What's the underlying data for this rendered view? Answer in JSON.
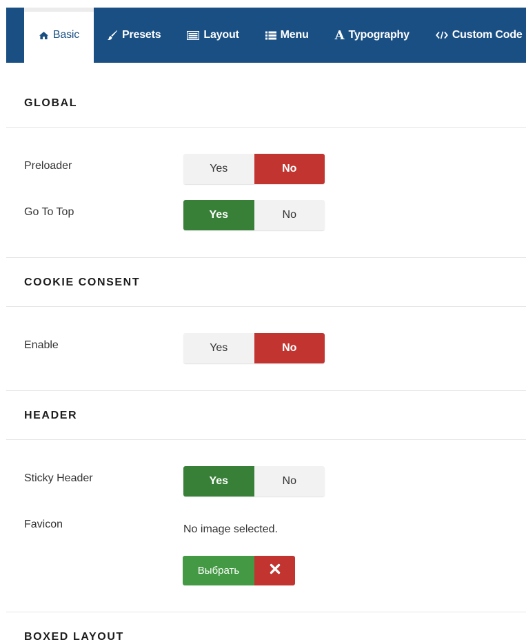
{
  "tabs": [
    {
      "label": "Basic",
      "icon": "home-icon",
      "active": true
    },
    {
      "label": "Presets",
      "icon": "brush-icon"
    },
    {
      "label": "Layout",
      "icon": "layout-icon"
    },
    {
      "label": "Menu",
      "icon": "list-icon"
    },
    {
      "label": "Typography",
      "icon": "typography-icon"
    },
    {
      "label": "Custom Code",
      "icon": "code-icon"
    }
  ],
  "sections": {
    "global": {
      "title": "GLOBAL",
      "preloader": {
        "label": "Preloader",
        "yes": "Yes",
        "no": "No",
        "value": "No"
      },
      "go_to_top": {
        "label": "Go To Top",
        "yes": "Yes",
        "no": "No",
        "value": "Yes"
      }
    },
    "cookie": {
      "title": "COOKIE CONSENT",
      "enable": {
        "label": "Enable",
        "yes": "Yes",
        "no": "No",
        "value": "No"
      }
    },
    "header": {
      "title": "HEADER",
      "sticky": {
        "label": "Sticky Header",
        "yes": "Yes",
        "no": "No",
        "value": "Yes"
      },
      "favicon": {
        "label": "Favicon",
        "status": "No image selected.",
        "choose_label": "Выбрать"
      }
    },
    "boxed": {
      "title": "BOXED LAYOUT"
    }
  },
  "colors": {
    "tabbar": "#1a4f84",
    "yes_active": "#388038",
    "no_active": "#c23430",
    "choose": "#449944"
  }
}
